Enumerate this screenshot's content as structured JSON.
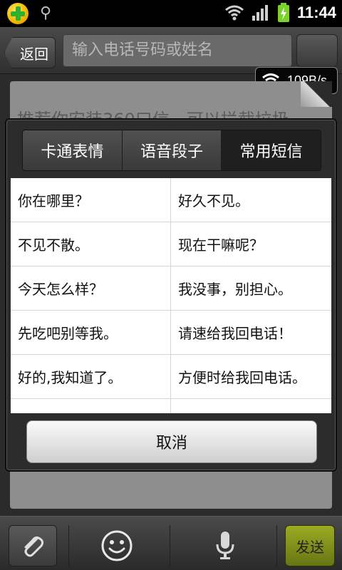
{
  "status_bar": {
    "time": "11:44"
  },
  "top_bar": {
    "back_label": "返回",
    "search_placeholder": "输入电话号码或姓名",
    "net_speed": "109B/s"
  },
  "background": {
    "recommend_text": "推荐你安装360口信，可以拦截垃圾"
  },
  "dialog": {
    "tabs": [
      {
        "label": "卡通表情",
        "active": false
      },
      {
        "label": "语音段子",
        "active": false
      },
      {
        "label": "常用短信",
        "active": true
      }
    ],
    "messages": [
      "你在哪里？",
      "好久不见。",
      "不见不散。",
      "现在干嘛呢？",
      "今天怎么样？",
      "我没事，别担心。",
      "先吃吧别等我。",
      "请速给我回电话！",
      "好的,我知道了。",
      "方便时给我回电话。",
      "",
      ""
    ],
    "cancel_label": "取消"
  },
  "bottom_bar": {
    "send_label": "发送"
  },
  "colors": {
    "send_button": "#8a9a1c",
    "dialog_bg": "#2c2c2c",
    "active_tab": "#1f1f1f"
  }
}
